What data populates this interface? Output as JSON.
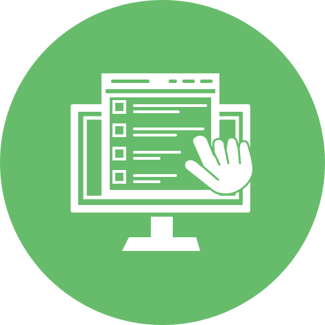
{
  "icon": {
    "name": "checklist-monitor-click-icon",
    "colors": {
      "background": "#67bc6b",
      "foreground": "#ffffff"
    },
    "checklist_items": 4
  }
}
